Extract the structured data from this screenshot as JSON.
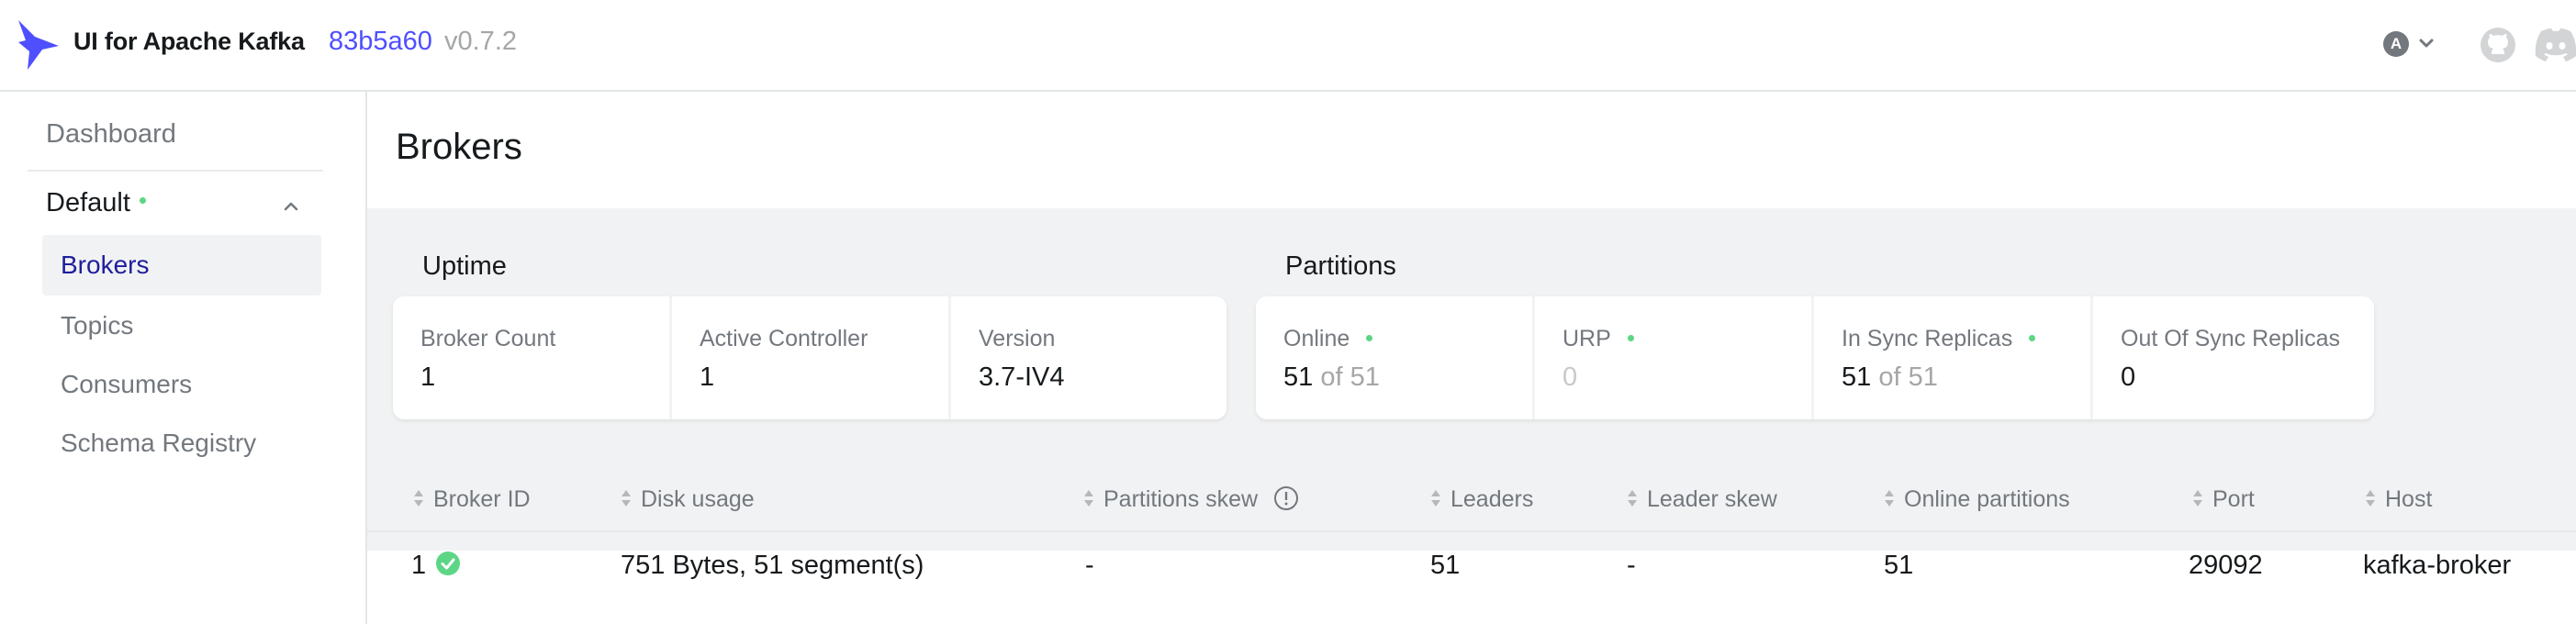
{
  "navbar": {
    "app_title": "UI for Apache Kafka",
    "commit": "83b5a60",
    "version": "v0.7.2",
    "user_initial": "A"
  },
  "sidebar": {
    "dashboard_label": "Dashboard",
    "cluster_name": "Default",
    "cluster_status_color": "#5cd685",
    "items": [
      {
        "label": "Brokers",
        "active": true
      },
      {
        "label": "Topics",
        "active": false
      },
      {
        "label": "Consumers",
        "active": false
      },
      {
        "label": "Schema Registry",
        "active": false
      }
    ]
  },
  "page": {
    "title": "Brokers"
  },
  "uptime": {
    "section_title": "Uptime",
    "broker_count_label": "Broker Count",
    "broker_count_value": "1",
    "active_controller_label": "Active Controller",
    "active_controller_value": "1",
    "version_label": "Version",
    "version_value": "3.7-IV4"
  },
  "partitions": {
    "section_title": "Partitions",
    "online_label": "Online",
    "online_value": "51",
    "online_of": "of 51",
    "urp_label": "URP",
    "urp_value": "0",
    "in_sync_label": "In Sync Replicas",
    "in_sync_value": "51",
    "in_sync_of": "of 51",
    "out_of_sync_label": "Out Of Sync Replicas",
    "out_of_sync_value": "0"
  },
  "table": {
    "columns": [
      "Broker ID",
      "Disk usage",
      "Partitions skew",
      "Leaders",
      "Leader skew",
      "Online partitions",
      "Port",
      "Host"
    ],
    "rows": [
      {
        "broker_id": "1",
        "disk_usage": "751 Bytes, 51 segment(s)",
        "partitions_skew": "-",
        "leaders": "51",
        "leader_skew": "-",
        "online_partitions": "51",
        "port": "29092",
        "host": "kafka-broker"
      }
    ]
  },
  "colors": {
    "accent": "#4f4fff",
    "active_nav": "#1e1e9d",
    "status_green": "#5cd685",
    "muted": "#73787e"
  }
}
